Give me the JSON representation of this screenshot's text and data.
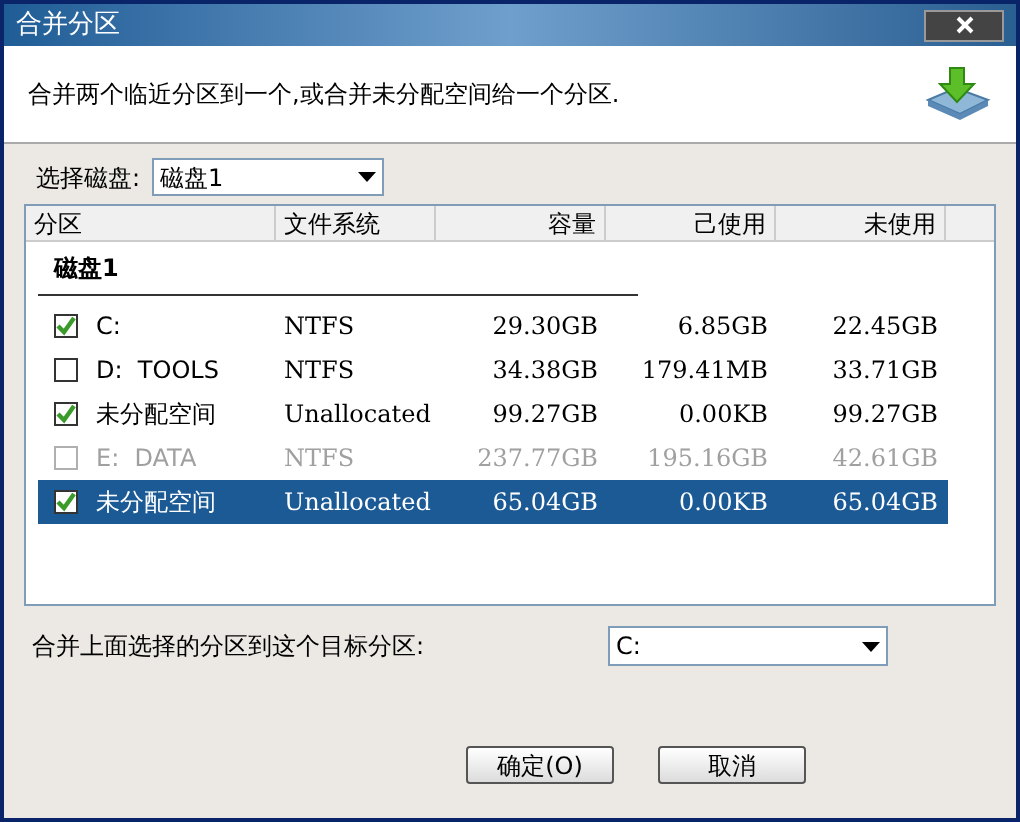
{
  "window": {
    "title": "合并分区"
  },
  "description": "合并两个临近分区到一个,或合并未分配空间给一个分区.",
  "disk_select": {
    "label": "选择磁盘:",
    "value": "磁盘1"
  },
  "table": {
    "columns": [
      "分区",
      "文件系统",
      "容量",
      "己使用",
      "未使用"
    ],
    "group": "磁盘1",
    "rows": [
      {
        "name": "C:",
        "fs": "NTFS",
        "capacity": "29.30GB",
        "used": "6.85GB",
        "free": "22.45GB",
        "checked": true,
        "disabled": false,
        "selected": false
      },
      {
        "name": "D:  TOOLS",
        "fs": "NTFS",
        "capacity": "34.38GB",
        "used": "179.41MB",
        "free": "33.71GB",
        "checked": false,
        "disabled": false,
        "selected": false
      },
      {
        "name": "未分配空间",
        "fs": "Unallocated",
        "capacity": "99.27GB",
        "used": "0.00KB",
        "free": "99.27GB",
        "checked": true,
        "disabled": false,
        "selected": false
      },
      {
        "name": "E:  DATA",
        "fs": "NTFS",
        "capacity": "237.77GB",
        "used": "195.16GB",
        "free": "42.61GB",
        "checked": false,
        "disabled": true,
        "selected": false
      },
      {
        "name": "未分配空间",
        "fs": "Unallocated",
        "capacity": "65.04GB",
        "used": "0.00KB",
        "free": "65.04GB",
        "checked": true,
        "disabled": false,
        "selected": true
      }
    ]
  },
  "target": {
    "label": "合并上面选择的分区到这个目标分区:",
    "value": "C:"
  },
  "buttons": [
    "确定(O)",
    "取消"
  ]
}
